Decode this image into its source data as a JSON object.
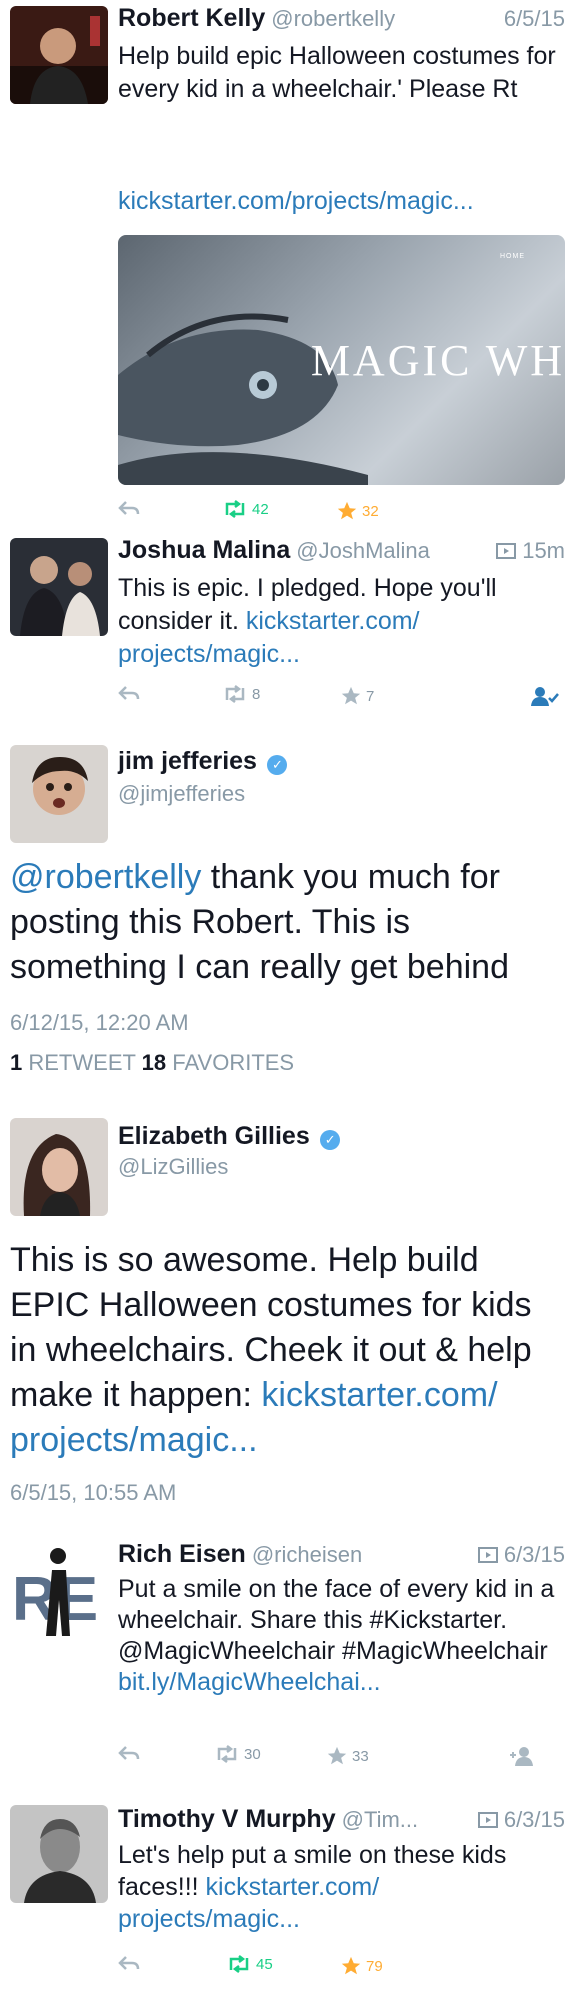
{
  "tweets": [
    {
      "name": "Robert Kelly",
      "handle": "@robertkelly",
      "time": "6/5/15",
      "text": "Help build epic Halloween costumes for every kid in a wheelchair.' Please Rt",
      "link": "kickstarter.com/projects/magic...",
      "card": {
        "home_label": "HOME",
        "title": "MAGIC WH"
      },
      "retweets": "42",
      "favorites": "32"
    },
    {
      "name": "Joshua Malina",
      "handle": "@JoshMalina",
      "time": "15m",
      "text": "This is epic. I pledged. Hope you'll consider it.",
      "link": "kickstarter.com/ projects/magic...",
      "retweets": "8",
      "favorites": "7"
    },
    {
      "name": "jim jefferies",
      "handle": "@jimjefferies",
      "mention": "@robertkelly",
      "text": " thank you much for posting this Robert. This is something I can really get behind",
      "datetime": "6/12/15, 12:20 AM",
      "retweets_count": "1",
      "retweets_label": "RETWEET",
      "favorites_count": "18",
      "favorites_label": "FAVORITES"
    },
    {
      "name": "Elizabeth Gillies",
      "handle": "@LizGillies",
      "text": "This is so awesome. Help build EPIC Halloween costumes for kids in wheelchairs. Cheek it out & help make it happen: ",
      "link": "kickstarter.com/ projects/magic...",
      "datetime": "6/5/15, 10:55 AM"
    },
    {
      "name": "Rich Eisen",
      "handle": "@richeisen",
      "time": "6/3/15",
      "text": "Put a smile on the face of every kid in a wheelchair. Share this #Kickstarter. @MagicWheelchair #MagicWheelchair",
      "link": "bit.ly/MagicWheelchai...",
      "retweets": "30",
      "favorites": "33"
    },
    {
      "name": "Timothy V Murphy",
      "handle": "@Tim...",
      "time": "6/3/15",
      "text": "Let's help put a smile on these kids faces!!! ",
      "link": "kickstarter.com/ projects/magic...",
      "retweets": "45",
      "favorites": "79"
    }
  ],
  "colors": {
    "link": "#2b7bb9",
    "retweet": "#19cf86",
    "favorite": "#ffac33",
    "muted": "#8899a6",
    "verified": "#55acee"
  },
  "icons": [
    "reply-icon",
    "retweet-icon",
    "star-icon",
    "verified-icon",
    "video-icon",
    "follow-icon"
  ]
}
